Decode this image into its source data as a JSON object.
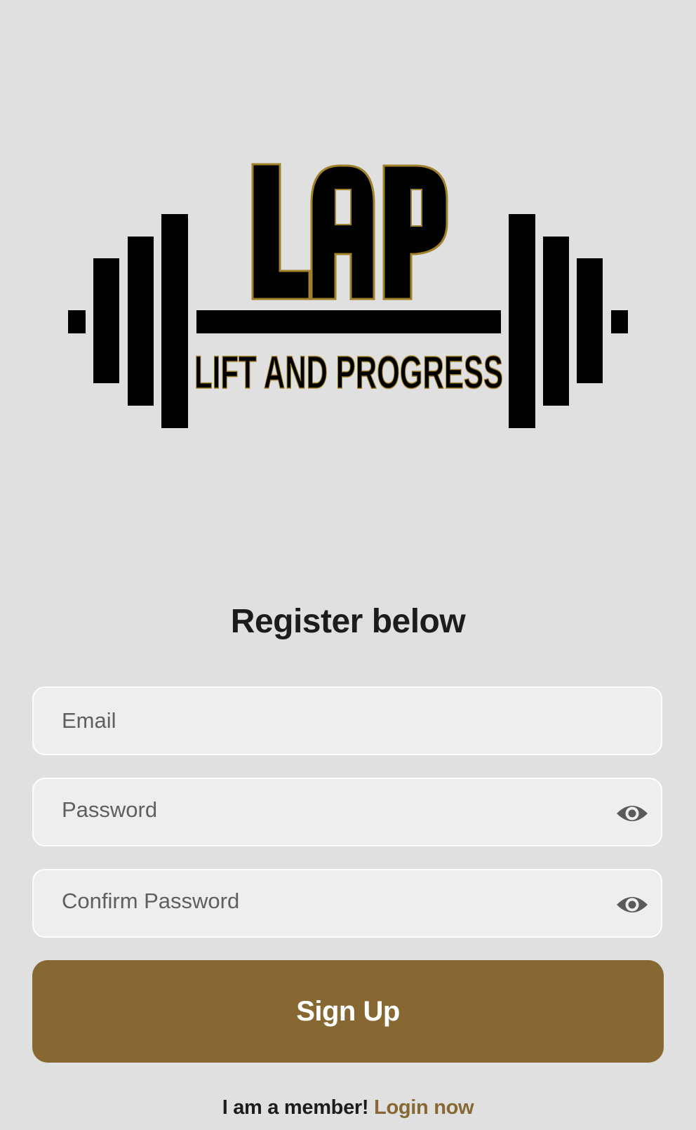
{
  "logo": {
    "title": "LAP",
    "tagline": "LIFT AND PROGRESS",
    "accent_color": "#a08029",
    "icon": "barbell-icon"
  },
  "form": {
    "heading": "Register below",
    "email_placeholder": "Email",
    "password_placeholder": "Password",
    "confirm_placeholder": "Confirm Password",
    "visibility_icon": "eye-icon",
    "submit_label": "Sign Up"
  },
  "footer": {
    "prompt": "I am a member!",
    "link_label": "Login now"
  },
  "colors": {
    "background": "#e0e0e0",
    "brand": "#876832",
    "field_background": "#eeeeee",
    "field_border": "#ffffff",
    "heading_text": "#1c1c1c"
  }
}
